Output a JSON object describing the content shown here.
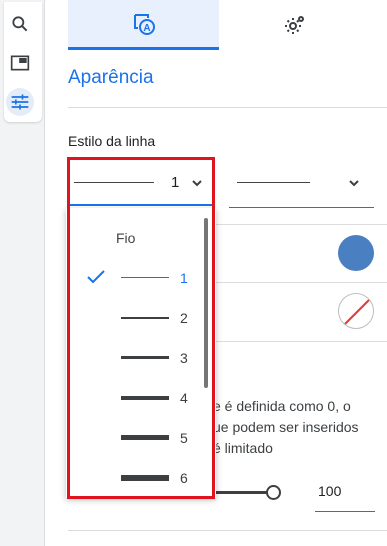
{
  "rail": {
    "items": [
      {
        "icon": "search-icon"
      },
      {
        "icon": "picture-in-picture-icon"
      },
      {
        "icon": "tune-icon",
        "active": true
      }
    ]
  },
  "tabs": [
    {
      "icon": "appearance-icon",
      "active": true
    },
    {
      "icon": "settings-gear-icon",
      "active": false
    }
  ],
  "section_title": "Aparência",
  "line_style": {
    "label": "Estilo da linha",
    "width_value": "1"
  },
  "width_dropdown": {
    "header": "Fio",
    "options": [
      "1",
      "2",
      "3",
      "4",
      "5",
      "6"
    ],
    "selected": "1"
  },
  "help_text": "e é definida como 0, o\nue podem ser inseridos\né limitado",
  "limit_input": {
    "value": "100"
  },
  "colors": {
    "accent": "#1a73e8",
    "swatch": "#4a7fc1",
    "highlight": "#e0141f"
  }
}
